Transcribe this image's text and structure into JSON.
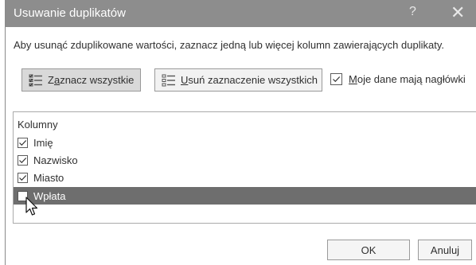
{
  "dialog": {
    "title": "Usuwanie duplikatów",
    "help": "?",
    "close": "✕",
    "instruction": "Aby usunąć zduplikowane wartości, zaznacz jedną lub więcej kolumn zawierających duplikaty."
  },
  "buttons": {
    "select_all_accel": "a",
    "select_all_pre": "Z",
    "select_all_post": "znacz wszystkie",
    "unselect_all_accel": "U",
    "unselect_all_post": "suń zaznaczenie wszystkich",
    "ok": "OK",
    "cancel": "Anuluj"
  },
  "headers_option": {
    "accel": "M",
    "label_post": "oje dane mają nagłówki",
    "checked": true
  },
  "list": {
    "header": "Kolumny",
    "items": [
      {
        "label": "Imię",
        "checked": true
      },
      {
        "label": "Nazwisko",
        "checked": true
      },
      {
        "label": "Miasto",
        "checked": true
      },
      {
        "label": "Wpłata",
        "checked": false,
        "selected": true
      }
    ]
  },
  "icons": {
    "select_all": "select-all-icon",
    "unselect_all": "unselect-all-icon",
    "check": "check-icon",
    "cursor": "pointer-cursor-icon"
  },
  "colors": {
    "titlebar": "#8d8d8d",
    "selected_row": "#6e6e6e"
  }
}
